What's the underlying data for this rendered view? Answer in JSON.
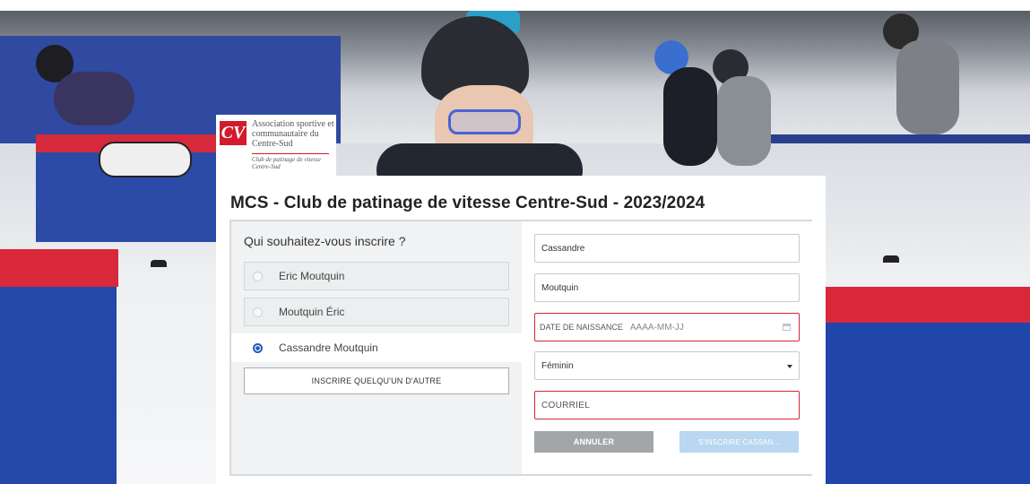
{
  "logo": {
    "mark": "CV",
    "org_name": "Association sportive et communautaire du Centre-Sud",
    "club_name": "Club de patinage de vitesse Centre-Sud",
    "brand_color": "#d21b2c"
  },
  "page_title": "MCS - Club de patinage de vitesse Centre-Sud - 2023/2024",
  "registrant": {
    "question": "Qui souhaitez-vous inscrire ?",
    "options": [
      {
        "label": "Eric Moutquin",
        "selected": false
      },
      {
        "label": "Moutquin Éric",
        "selected": false
      },
      {
        "label": "Cassandre Moutquin",
        "selected": true
      }
    ],
    "add_other_label": "INSCRIRE QUELQU'UN D'AUTRE"
  },
  "form": {
    "first_name": "Cassandre",
    "last_name": "Moutquin",
    "dob_label": "DATE DE NAISSANCE",
    "dob_placeholder": "AAAA-MM-JJ",
    "gender": "Féminin",
    "email_placeholder": "COURRIEL",
    "cancel_label": "ANNULER",
    "submit_label": "S'INSCRIRE CASSAN..."
  },
  "colors": {
    "accent": "#1f5fb7",
    "error_border": "#d0283a",
    "cancel_bg": "#a3a6a9",
    "submit_bg_disabled": "#b9d7f0"
  }
}
